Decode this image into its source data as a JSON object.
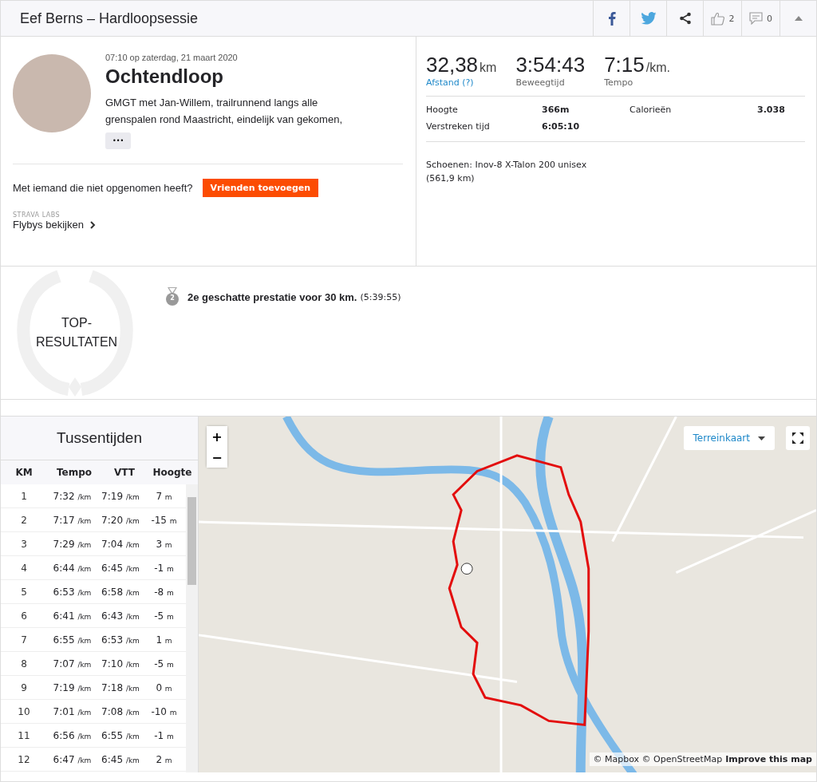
{
  "header": {
    "title": "Eef Berns – Hardloopsessie",
    "kudos_count": "2",
    "comment_count": "0"
  },
  "activity": {
    "datetime": "07:10 op zaterdag, 21 maart 2020",
    "name": "Ochtendloop",
    "description": "GMGT met Jan-Willem, trailrunnend langs alle grenspalen rond Maastricht, eindelijk van gekomen,",
    "more_button": "•••",
    "invite": {
      "text": "Met iemand die niet opgenomen heeft?",
      "button": "Vrienden toevoegen"
    },
    "labs": {
      "label": "STRAVA LABS",
      "link": "Flybys bekijken"
    }
  },
  "stats": {
    "primary": [
      {
        "value": "32,38",
        "unit": "km",
        "label": "Afstand (?)",
        "kind": "link"
      },
      {
        "value": "3:54:43",
        "label": "Beweegtijd",
        "kind": "plain"
      },
      {
        "value": "7:15",
        "unit": "/km.",
        "label": "Tempo",
        "kind": "plain"
      }
    ],
    "secondary": [
      {
        "label": "Hoogte",
        "value": "366m"
      },
      {
        "label": "Calorieën",
        "value": "3.038"
      },
      {
        "label": "Verstreken tijd",
        "value": "6:05:10"
      }
    ],
    "shoes": "Schoenen: Inov-8 X-Talon 200 unisex (561,9 km)"
  },
  "top_results": {
    "title": "TOP-RESULTATEN",
    "achievements": [
      {
        "rank": "2",
        "text": "2e geschatte prestatie voor 30 km.",
        "time": "(5:39:55)"
      }
    ]
  },
  "splits": {
    "title": "Tussentijden",
    "columns": [
      "KM",
      "Tempo",
      "VTT",
      "Hoogte"
    ],
    "rows": [
      {
        "km": "1",
        "pace": "7:32",
        "pace_unit": "/km",
        "gap": "7:19",
        "gap_unit": "/km",
        "elev": "7",
        "elev_unit": "m"
      },
      {
        "km": "2",
        "pace": "7:17",
        "pace_unit": "/km",
        "gap": "7:20",
        "gap_unit": "/km",
        "elev": "-15",
        "elev_unit": "m"
      },
      {
        "km": "3",
        "pace": "7:29",
        "pace_unit": "/km",
        "gap": "7:04",
        "gap_unit": "/km",
        "elev": "3",
        "elev_unit": "m"
      },
      {
        "km": "4",
        "pace": "6:44",
        "pace_unit": "/km",
        "gap": "6:45",
        "gap_unit": "/km",
        "elev": "-1",
        "elev_unit": "m"
      },
      {
        "km": "5",
        "pace": "6:53",
        "pace_unit": "/km",
        "gap": "6:58",
        "gap_unit": "/km",
        "elev": "-8",
        "elev_unit": "m"
      },
      {
        "km": "6",
        "pace": "6:41",
        "pace_unit": "/km",
        "gap": "6:43",
        "gap_unit": "/km",
        "elev": "-5",
        "elev_unit": "m"
      },
      {
        "km": "7",
        "pace": "6:55",
        "pace_unit": "/km",
        "gap": "6:53",
        "gap_unit": "/km",
        "elev": "1",
        "elev_unit": "m"
      },
      {
        "km": "8",
        "pace": "7:07",
        "pace_unit": "/km",
        "gap": "7:10",
        "gap_unit": "/km",
        "elev": "-5",
        "elev_unit": "m"
      },
      {
        "km": "9",
        "pace": "7:19",
        "pace_unit": "/km",
        "gap": "7:18",
        "gap_unit": "/km",
        "elev": "0",
        "elev_unit": "m"
      },
      {
        "km": "10",
        "pace": "7:01",
        "pace_unit": "/km",
        "gap": "7:08",
        "gap_unit": "/km",
        "elev": "-10",
        "elev_unit": "m"
      },
      {
        "km": "11",
        "pace": "6:56",
        "pace_unit": "/km",
        "gap": "6:55",
        "gap_unit": "/km",
        "elev": "-1",
        "elev_unit": "m"
      },
      {
        "km": "12",
        "pace": "6:47",
        "pace_unit": "/km",
        "gap": "6:45",
        "gap_unit": "/km",
        "elev": "2",
        "elev_unit": "m"
      }
    ]
  },
  "map": {
    "zoom_in": "+",
    "zoom_out": "−",
    "map_type": "Terreinkaart",
    "attribution": "© Mapbox © OpenStreetMap",
    "improve_link": "Improve this map"
  }
}
